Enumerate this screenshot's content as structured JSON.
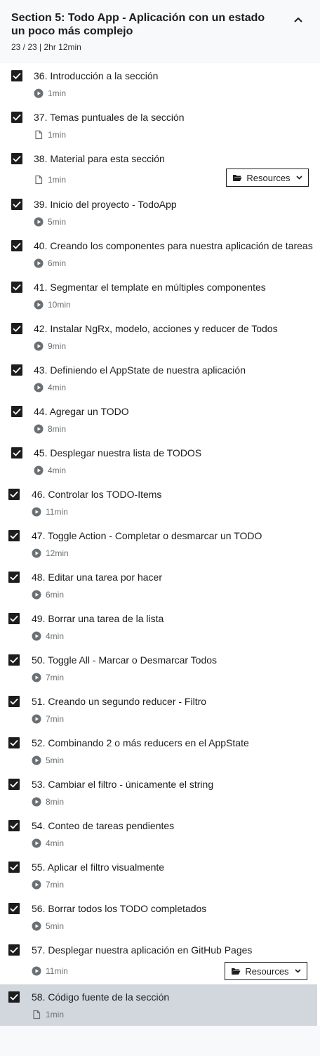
{
  "section": {
    "title": "Section 5: Todo App - Aplicación con un estado un poco más complejo",
    "meta": "23 / 23 | 2hr 12min"
  },
  "resources_label": "Resources",
  "items": [
    {
      "title": "36. Introducción a la sección",
      "duration": "1min",
      "type": "video"
    },
    {
      "title": "37. Temas puntuales de la sección",
      "duration": "1min",
      "type": "file"
    },
    {
      "title": "38. Material para esta sección",
      "duration": "1min",
      "type": "file",
      "resources": true
    },
    {
      "title": "39. Inicio del proyecto - TodoApp",
      "duration": "5min",
      "type": "video"
    },
    {
      "title": "40. Creando los componentes para nuestra aplicación de tareas",
      "duration": "6min",
      "type": "video"
    },
    {
      "title": "41. Segmentar el template en múltiples componentes",
      "duration": "10min",
      "type": "video"
    },
    {
      "title": "42. Instalar NgRx, modelo, acciones y reducer de Todos",
      "duration": "9min",
      "type": "video"
    },
    {
      "title": "43. Definiendo el AppState de nuestra aplicación",
      "duration": "4min",
      "type": "video"
    },
    {
      "title": "44. Agregar un TODO",
      "duration": "8min",
      "type": "video"
    },
    {
      "title": "45. Desplegar nuestra lista de TODOS",
      "duration": "4min",
      "type": "video"
    },
    {
      "title": "46. Controlar los TODO-Items",
      "duration": "11min",
      "type": "video"
    },
    {
      "title": "47. Toggle Action - Completar o desmarcar un TODO",
      "duration": "12min",
      "type": "video"
    },
    {
      "title": "48. Editar una tarea por hacer",
      "duration": "6min",
      "type": "video"
    },
    {
      "title": "49. Borrar una tarea de la lista",
      "duration": "4min",
      "type": "video"
    },
    {
      "title": "50. Toggle All - Marcar o Desmarcar Todos",
      "duration": "7min",
      "type": "video"
    },
    {
      "title": "51. Creando un segundo reducer - Filtro",
      "duration": "7min",
      "type": "video"
    },
    {
      "title": "52. Combinando 2 o más reducers en el AppState",
      "duration": "5min",
      "type": "video"
    },
    {
      "title": "53. Cambiar el filtro - únicamente el string",
      "duration": "8min",
      "type": "video"
    },
    {
      "title": "54. Conteo de tareas pendientes",
      "duration": "4min",
      "type": "video"
    },
    {
      "title": "55. Aplicar el filtro visualmente",
      "duration": "7min",
      "type": "video"
    },
    {
      "title": "56. Borrar todos los TODO completados",
      "duration": "5min",
      "type": "video"
    },
    {
      "title": "57. Desplegar nuestra aplicación en GitHub Pages",
      "duration": "11min",
      "type": "video",
      "resources": true
    },
    {
      "title": "58. Código fuente de la sección",
      "duration": "1min",
      "type": "file",
      "current": true
    }
  ],
  "colors": {
    "checkbox": "#1c1d1f",
    "current_bg": "#d1d7dc",
    "meta_text": "#6a6f73"
  },
  "icons": {
    "video": "play-circle-icon",
    "file": "file-icon",
    "collapse": "chevron-up-icon",
    "resources": "folder-open-icon",
    "dropdown": "chevron-down-icon",
    "checked": "checkmark-icon"
  }
}
